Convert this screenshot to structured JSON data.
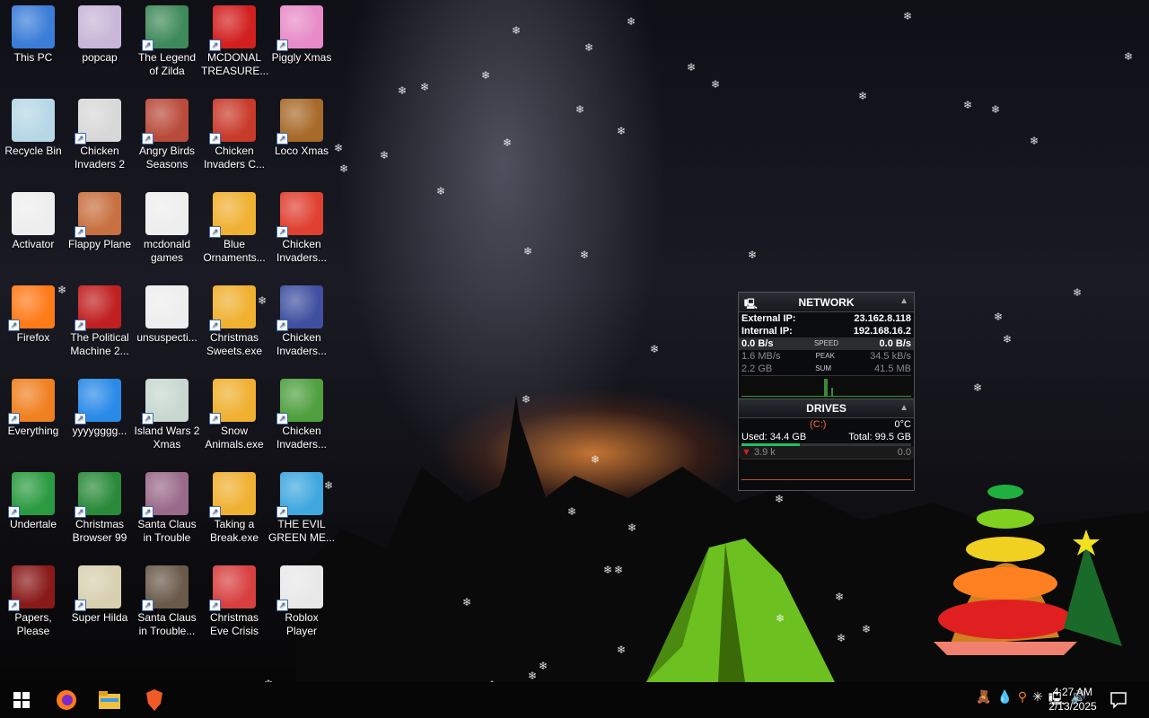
{
  "desktop": {
    "icons": [
      {
        "label": "This PC",
        "shortcut": false,
        "icon": "monitor-icon",
        "color": "#3b7dd8"
      },
      {
        "label": "popcap",
        "shortcut": false,
        "icon": "popcap-icon",
        "color": "#c9b6d8"
      },
      {
        "label": "The Legend of Zilda",
        "shortcut": true,
        "icon": "zilda-icon",
        "color": "#3f8a5a"
      },
      {
        "label": "MCDONAL TREASURE...",
        "shortcut": true,
        "icon": "mcdonalds-icon",
        "color": "#d21f1f"
      },
      {
        "label": "Piggly Xmas",
        "shortcut": true,
        "icon": "pig-icon",
        "color": "#e88bc8"
      },
      {
        "label": "Recycle Bin",
        "shortcut": false,
        "icon": "recycle-bin-icon",
        "color": "#b6d8e6"
      },
      {
        "label": "Chicken Invaders 2",
        "shortcut": true,
        "icon": "chicken-invaders-2-icon",
        "color": "#d8d8d8"
      },
      {
        "label": "Angry Birds Seasons",
        "shortcut": true,
        "icon": "angry-birds-icon",
        "color": "#b94b3a"
      },
      {
        "label": "Chicken Invaders C...",
        "shortcut": true,
        "icon": "chicken-invaders-icon",
        "color": "#c83a2a"
      },
      {
        "label": "Loco Xmas",
        "shortcut": true,
        "icon": "bear-icon",
        "color": "#a86a2a"
      },
      {
        "label": "Activator",
        "shortcut": false,
        "icon": "file-icon",
        "color": "#eeeeee"
      },
      {
        "label": "Flappy Plane",
        "shortcut": true,
        "icon": "flappy-plane-icon",
        "color": "#c87040"
      },
      {
        "label": "mcdonald games",
        "shortcut": false,
        "icon": "file-icon",
        "color": "#eeeeee"
      },
      {
        "label": "Blue Ornaments...",
        "shortcut": true,
        "icon": "popcap-game-icon",
        "color": "#f0b030"
      },
      {
        "label": "Chicken Invaders...",
        "shortcut": true,
        "icon": "chicken-invaders-icon",
        "color": "#e04030"
      },
      {
        "label": "Firefox",
        "shortcut": true,
        "icon": "firefox-icon",
        "color": "#ff7a18"
      },
      {
        "label": "The Political Machine 2...",
        "shortcut": true,
        "icon": "political-machine-icon",
        "color": "#c02020"
      },
      {
        "label": "unsuspecti...",
        "shortcut": false,
        "icon": "file-icon",
        "color": "#eeeeee"
      },
      {
        "label": "Christmas Sweets.exe",
        "shortcut": true,
        "icon": "popcap-game-icon",
        "color": "#f0b030"
      },
      {
        "label": "Chicken Invaders...",
        "shortcut": true,
        "icon": "chicken-invaders-icon",
        "color": "#4050a0"
      },
      {
        "label": "Everything",
        "shortcut": true,
        "icon": "everything-search-icon",
        "color": "#f08020"
      },
      {
        "label": "yyyygggg...",
        "shortcut": true,
        "icon": "roblox-studio-icon",
        "color": "#2a8ae8"
      },
      {
        "label": "Island Wars 2 Xmas",
        "shortcut": true,
        "icon": "island-wars-icon",
        "color": "#c8d8d0"
      },
      {
        "label": "Snow Animals.exe",
        "shortcut": true,
        "icon": "popcap-game-icon",
        "color": "#f0b030"
      },
      {
        "label": "Chicken Invaders...",
        "shortcut": true,
        "icon": "chicken-invaders-icon",
        "color": "#50a040"
      },
      {
        "label": "Undertale",
        "shortcut": true,
        "icon": "undertale-icon",
        "color": "#2a9a40"
      },
      {
        "label": "Christmas Browser 99",
        "shortcut": true,
        "icon": "christmas-tree-icon",
        "color": "#2a8a3a"
      },
      {
        "label": "Santa Claus in Trouble",
        "shortcut": true,
        "icon": "santa-claus-icon",
        "color": "#9a6a8a"
      },
      {
        "label": "Taking a Break.exe",
        "shortcut": true,
        "icon": "popcap-game-icon",
        "color": "#f0b030"
      },
      {
        "label": "THE EVIL GREEN ME...",
        "shortcut": true,
        "icon": "msn-messenger-icon",
        "color": "#40a8e0"
      },
      {
        "label": "Papers, Please",
        "shortcut": true,
        "icon": "papers-please-icon",
        "color": "#8a1a1a"
      },
      {
        "label": "Super Hilda",
        "shortcut": true,
        "icon": "super-hilda-icon",
        "color": "#d8d0b0"
      },
      {
        "label": "Santa Claus in Trouble...",
        "shortcut": true,
        "icon": "santa-claus-icon",
        "color": "#6a5a4a"
      },
      {
        "label": "Christmas Eve Crisis",
        "shortcut": true,
        "icon": "santa-face-icon",
        "color": "#d84040"
      },
      {
        "label": "Roblox Player",
        "shortcut": true,
        "icon": "roblox-icon",
        "color": "#e8e8e8"
      }
    ]
  },
  "widget": {
    "network": {
      "title": "NETWORK",
      "external_label": "External IP:",
      "external_value": "23.162.8.118",
      "internal_label": "Internal IP:",
      "internal_value": "192.168.16.2",
      "speed": {
        "left": "0.0 B/s",
        "mid": "SPEED",
        "right": "0.0 B/s"
      },
      "peak": {
        "left": "1.6 MB/s",
        "mid": "PEAK",
        "right": "34.5 kB/s"
      },
      "sum": {
        "left": "2.2 GB",
        "mid": "SUM",
        "right": "41.5 MB"
      }
    },
    "drives": {
      "title": "DRIVES",
      "drive_letter": "(C:)",
      "temp": "0°C",
      "used": "Used: 34.4 GB",
      "total": "Total: 99.5 GB",
      "activity_left": "3.9 k",
      "activity_right": "0.0",
      "used_fraction": 0.346
    }
  },
  "taskbar": {
    "clock_time": "4:27 AM",
    "clock_date": "2/13/2025",
    "pinned": [
      "start-button",
      "firefox-taskbar-icon",
      "file-explorer-taskbar-icon",
      "brave-taskbar-icon"
    ]
  },
  "colors": {
    "accent": "#2a8ae8",
    "brand_firefox": "#ff7a18",
    "brave": "#f05a24"
  }
}
